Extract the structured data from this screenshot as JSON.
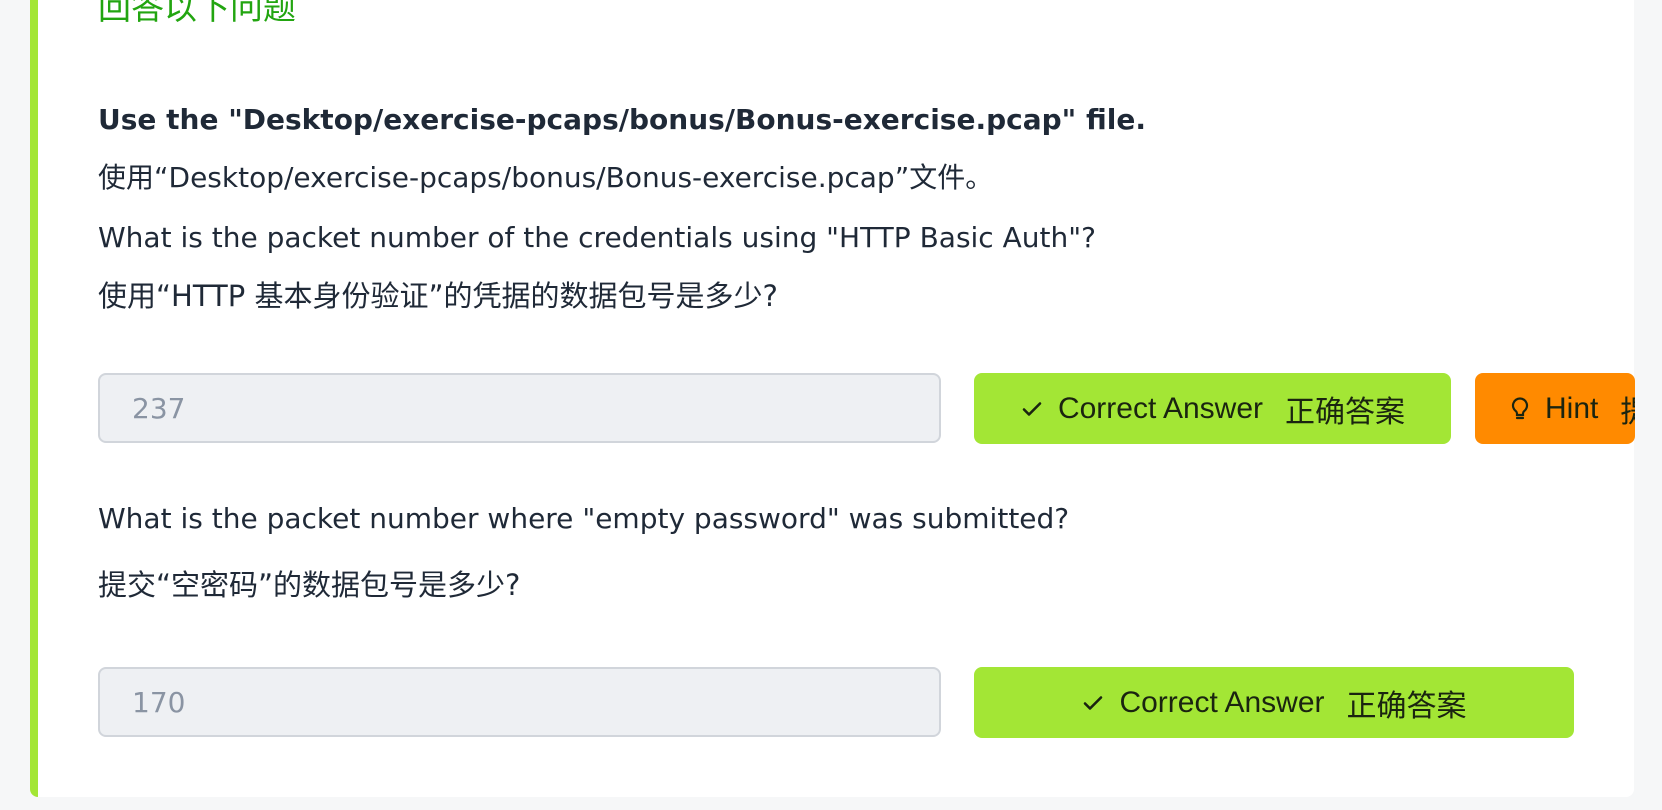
{
  "section": {
    "title": "回答以下问题"
  },
  "questions": {
    "intro_en": "Use the \"Desktop/exercise-pcaps/bonus/Bonus-exercise.pcap\" file.",
    "intro_zh": "使用“Desktop/exercise-pcaps/bonus/Bonus-exercise.pcap”文件。",
    "q1_en": "What is the packet number of the credentials using \"HTTP Basic Auth\"?",
    "q1_zh": "使用“HTTP 基本身份验证”的凭据的数据包号是多少?",
    "q1_answer": "237",
    "q2_en": "What is the packet number where \"empty password\" was submitted?",
    "q2_zh": "提交“空密码”的数据包号是多少?",
    "q2_answer": "170"
  },
  "buttons": {
    "correct_en": "Correct Answer",
    "correct_zh": "正确答案",
    "hint_label": "Hint",
    "hint_zh_partial": "提"
  },
  "icons": {
    "check": "check-icon",
    "hint": "lightbulb-icon"
  },
  "colors": {
    "accent_green": "#a3e635",
    "title_green": "#22a510",
    "hint_orange": "#ff8a00"
  }
}
